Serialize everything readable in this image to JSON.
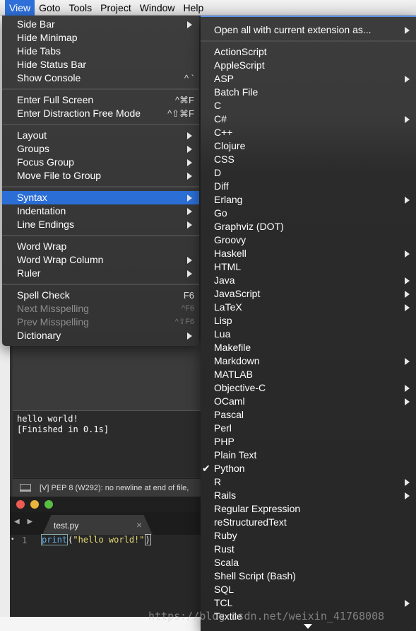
{
  "menubar": {
    "items": [
      "View",
      "Goto",
      "Tools",
      "Project",
      "Window",
      "Help"
    ],
    "active": "View"
  },
  "view_menu": {
    "groups": [
      [
        {
          "label": "Side Bar",
          "submenu": true
        },
        {
          "label": "Hide Minimap"
        },
        {
          "label": "Hide Tabs"
        },
        {
          "label": "Hide Status Bar"
        },
        {
          "label": "Show Console",
          "shortcut": "^ `"
        }
      ],
      [
        {
          "label": "Enter Full Screen",
          "shortcut": "^⌘F"
        },
        {
          "label": "Enter Distraction Free Mode",
          "shortcut": "^⇧⌘F"
        }
      ],
      [
        {
          "label": "Layout",
          "submenu": true
        },
        {
          "label": "Groups",
          "submenu": true
        },
        {
          "label": "Focus Group",
          "submenu": true
        },
        {
          "label": "Move File to Group",
          "submenu": true
        }
      ],
      [
        {
          "label": "Syntax",
          "submenu": true,
          "active": true
        },
        {
          "label": "Indentation",
          "submenu": true
        },
        {
          "label": "Line Endings",
          "submenu": true
        }
      ],
      [
        {
          "label": "Word Wrap"
        },
        {
          "label": "Word Wrap Column",
          "submenu": true
        },
        {
          "label": "Ruler",
          "submenu": true
        }
      ],
      [
        {
          "label": "Spell Check",
          "shortcut": "F6"
        },
        {
          "label": "Next Misspelling",
          "shortcut": "^F6",
          "disabled": true
        },
        {
          "label": "Prev Misspelling",
          "shortcut": "^⇧F6",
          "disabled": true
        },
        {
          "label": "Dictionary",
          "submenu": true
        }
      ]
    ]
  },
  "syntax_menu": {
    "open_all": {
      "label": "Open all with current extension as...",
      "submenu": true
    },
    "items": [
      {
        "label": "ActionScript"
      },
      {
        "label": "AppleScript"
      },
      {
        "label": "ASP",
        "submenu": true
      },
      {
        "label": "Batch File"
      },
      {
        "label": "C"
      },
      {
        "label": "C#",
        "submenu": true
      },
      {
        "label": "C++"
      },
      {
        "label": "Clojure"
      },
      {
        "label": "CSS"
      },
      {
        "label": "D"
      },
      {
        "label": "Diff"
      },
      {
        "label": "Erlang",
        "submenu": true
      },
      {
        "label": "Go"
      },
      {
        "label": "Graphviz (DOT)"
      },
      {
        "label": "Groovy"
      },
      {
        "label": "Haskell",
        "submenu": true
      },
      {
        "label": "HTML"
      },
      {
        "label": "Java",
        "submenu": true
      },
      {
        "label": "JavaScript",
        "submenu": true
      },
      {
        "label": "LaTeX",
        "submenu": true
      },
      {
        "label": "Lisp"
      },
      {
        "label": "Lua"
      },
      {
        "label": "Makefile"
      },
      {
        "label": "Markdown",
        "submenu": true
      },
      {
        "label": "MATLAB"
      },
      {
        "label": "Objective-C",
        "submenu": true
      },
      {
        "label": "OCaml",
        "submenu": true
      },
      {
        "label": "Pascal"
      },
      {
        "label": "Perl"
      },
      {
        "label": "PHP"
      },
      {
        "label": "Plain Text"
      },
      {
        "label": "Python",
        "checked": true
      },
      {
        "label": "R",
        "submenu": true
      },
      {
        "label": "Rails",
        "submenu": true
      },
      {
        "label": "Regular Expression"
      },
      {
        "label": "reStructuredText"
      },
      {
        "label": "Ruby"
      },
      {
        "label": "Rust"
      },
      {
        "label": "Scala"
      },
      {
        "label": "Shell Script (Bash)"
      },
      {
        "label": "SQL"
      },
      {
        "label": "TCL",
        "submenu": true
      },
      {
        "label": "Textile"
      }
    ]
  },
  "console": {
    "lines": [
      "hello world!",
      "[Finished in 0.1s]"
    ]
  },
  "status_bar": {
    "text": "[V] PEP 8 (W292): no newline at end of file,"
  },
  "editor": {
    "tab_label": "test.py",
    "tab_close": "×",
    "nav_arrows": "◀ ▶",
    "line_number": "1",
    "bullet": "•",
    "code_fn": "print",
    "code_open": "(",
    "code_str": "\"hello world!\"",
    "code_close": ")"
  },
  "watermark": "https://blog.csdn.net/weixin_41768008",
  "colors": {
    "menubar_active": "#2e6fd9",
    "menu_highlight": "#2a6ed6",
    "menu_bg": "#3a3a3a"
  }
}
